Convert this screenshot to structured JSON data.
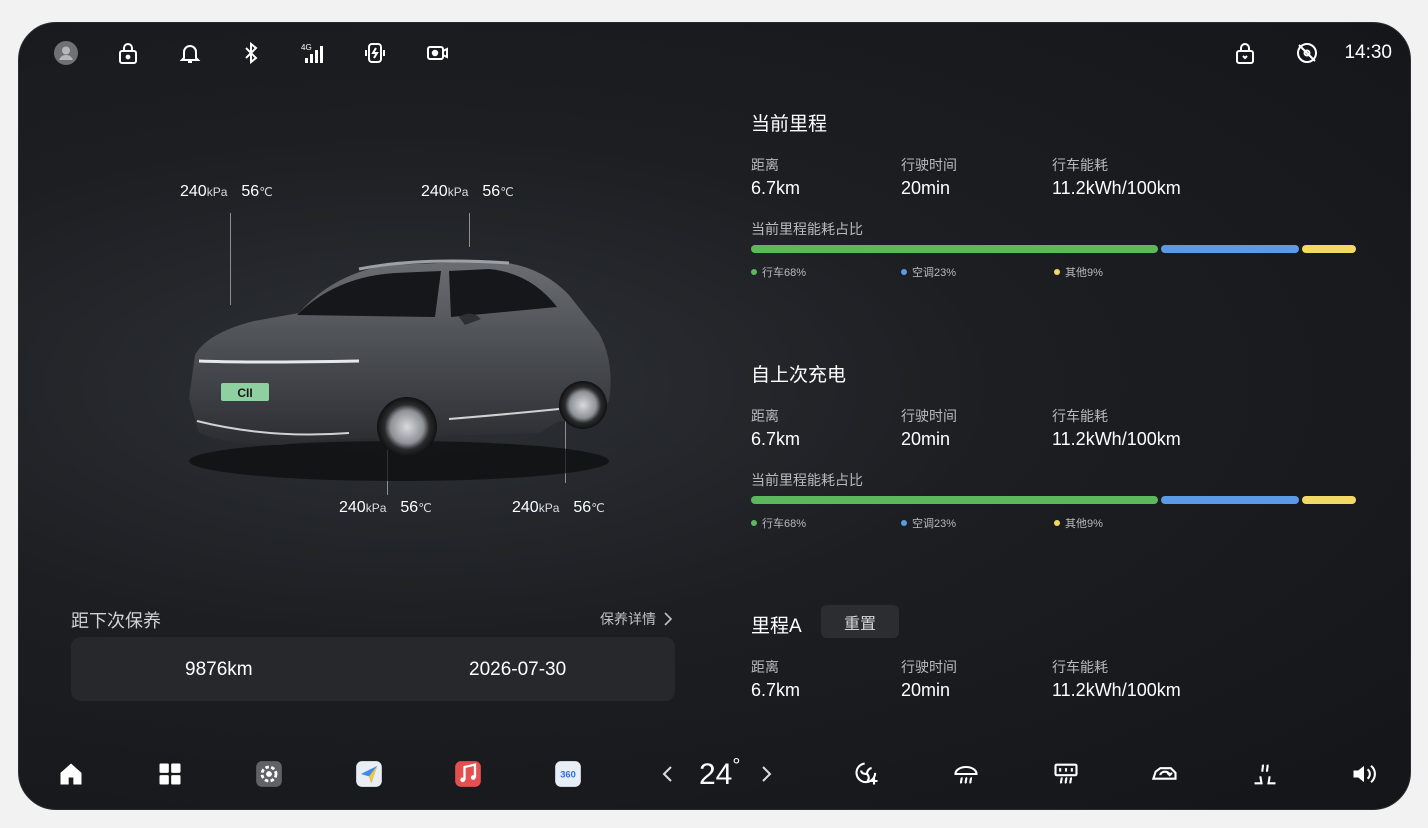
{
  "status_bar": {
    "time": "14:30",
    "icons": [
      "avatar",
      "lock-icon",
      "bell-icon",
      "bluetooth-icon",
      "signal-4g-icon",
      "power-saver-icon",
      "dashcam-icon",
      "child-lock-icon",
      "steering-wheel-off-icon"
    ],
    "signal_label": "4G"
  },
  "tires": {
    "unit_pressure": "kPa",
    "unit_temp": "℃",
    "front_left": {
      "pressure": "240",
      "temp": "56"
    },
    "front_right": {
      "pressure": "240",
      "temp": "56"
    },
    "rear_left": {
      "pressure": "240",
      "temp": "56"
    },
    "rear_right": {
      "pressure": "240",
      "temp": "56"
    }
  },
  "car": {
    "badge": "CII"
  },
  "maintenance": {
    "title": "距下次保养",
    "link": "保养详情",
    "distance": "9876km",
    "date": "2026-07-30"
  },
  "labels": {
    "distance": "距离",
    "time": "行驶时间",
    "energy": "行车能耗",
    "share_title": "当前里程能耗占比"
  },
  "current_trip": {
    "title": "当前里程",
    "distance": "6.7km",
    "time": "20min",
    "energy": "11.2kWh/100km",
    "breakdown": [
      {
        "label": "行车68%",
        "fraction": 0.68,
        "color": "#5cb85c"
      },
      {
        "label": "空调23%",
        "fraction": 0.23,
        "color": "#5b9be6"
      },
      {
        "label": "其他9%",
        "fraction": 0.09,
        "color": "#f2d864"
      }
    ]
  },
  "since_charge": {
    "title": "自上次充电",
    "distance": "6.7km",
    "time": "20min",
    "energy": "11.2kWh/100km",
    "breakdown": [
      {
        "label": "行车68%",
        "fraction": 0.68,
        "color": "#5cb85c"
      },
      {
        "label": "空调23%",
        "fraction": 0.23,
        "color": "#5b9be6"
      },
      {
        "label": "其他9%",
        "fraction": 0.09,
        "color": "#f2d864"
      }
    ]
  },
  "trip_a": {
    "title": "里程A",
    "reset_label": "重置",
    "distance": "6.7km",
    "time": "20min",
    "energy": "11.2kWh/100km"
  },
  "dock": {
    "temperature": "24",
    "degree": "°",
    "icons": [
      "home-icon",
      "apps-grid-icon",
      "settings-app-icon",
      "navigation-app-icon",
      "music-app-icon",
      "camera-360-app-icon",
      "fan-auto-icon",
      "front-defrost-icon",
      "rear-defrost-icon",
      "air-recirculation-icon",
      "seat-heat-icon",
      "volume-icon"
    ],
    "camera_label": "360"
  }
}
